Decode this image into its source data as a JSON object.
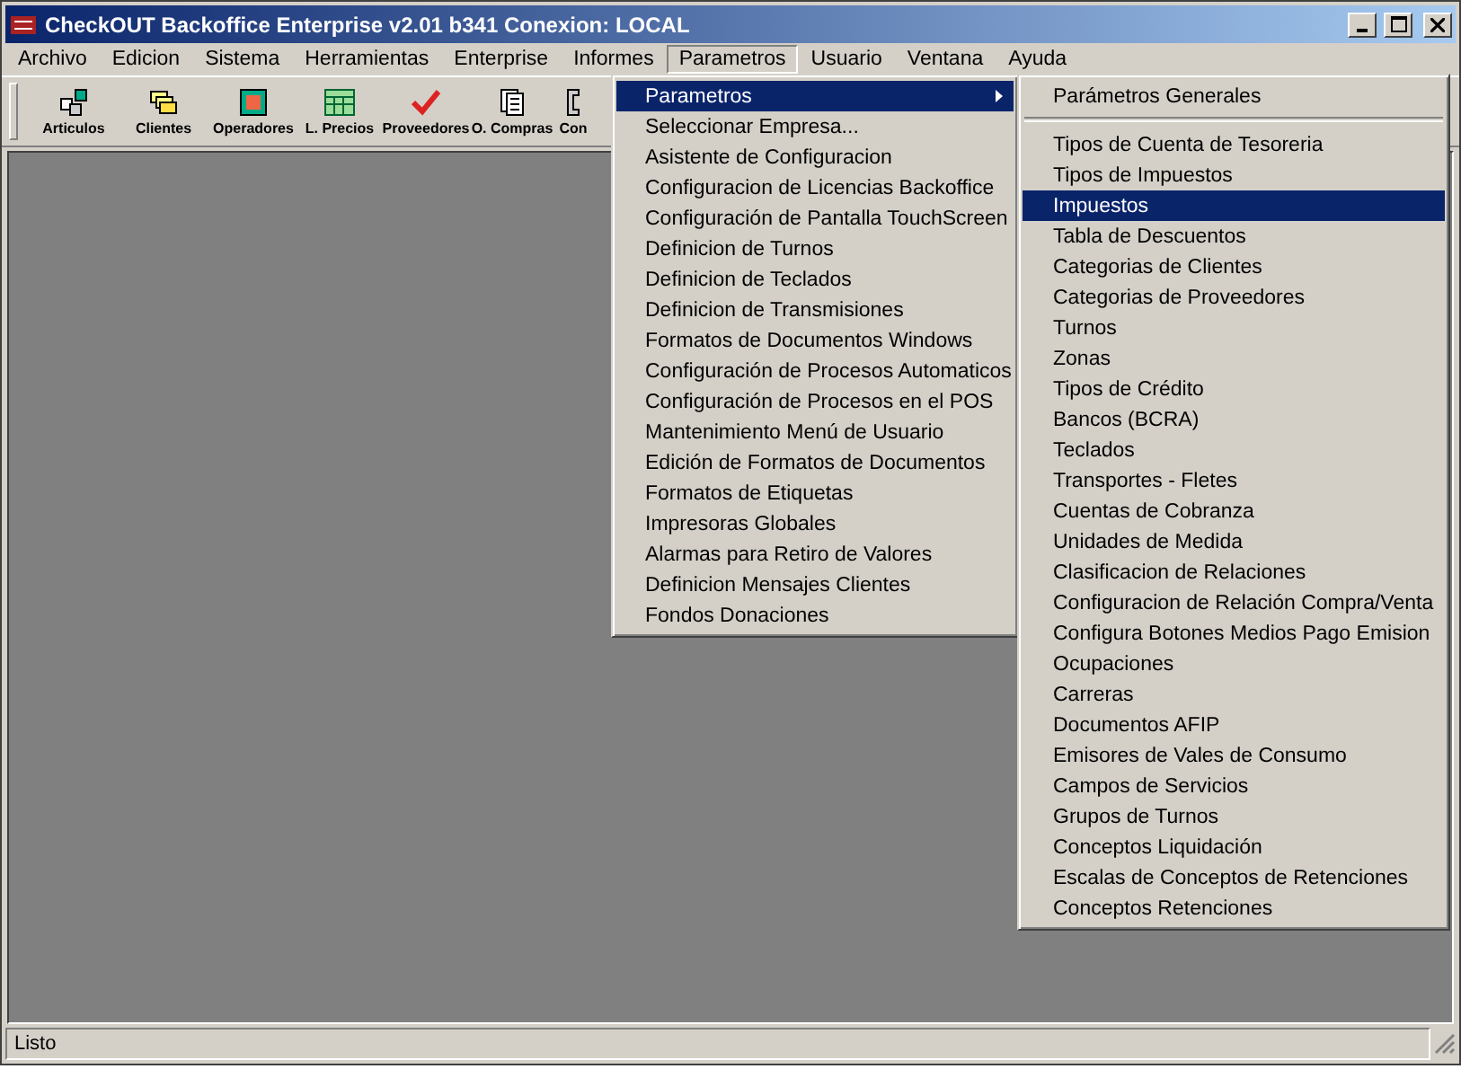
{
  "window": {
    "title": "CheckOUT Backoffice Enterprise v2.01 b341 Conexion: LOCAL"
  },
  "menu_bar": [
    {
      "label": "Archivo",
      "selected": false
    },
    {
      "label": "Edicion",
      "selected": false
    },
    {
      "label": "Sistema",
      "selected": false
    },
    {
      "label": "Herramientas",
      "selected": false
    },
    {
      "label": "Enterprise",
      "selected": false
    },
    {
      "label": "Informes",
      "selected": false
    },
    {
      "label": "Parametros",
      "selected": true
    },
    {
      "label": "Usuario",
      "selected": false
    },
    {
      "label": "Ventana",
      "selected": false
    },
    {
      "label": "Ayuda",
      "selected": false
    }
  ],
  "toolbar": [
    "Articulos",
    "Clientes",
    "Operadores",
    "L. Precios",
    "Proveedores",
    "O. Compras",
    "Con"
  ],
  "menu": [
    {
      "label": "Parametros",
      "selected": true,
      "submenu": true
    },
    {
      "label": "Seleccionar Empresa...",
      "selected": false
    },
    {
      "label": "Asistente de Configuracion",
      "selected": false
    },
    {
      "label": "Configuracion de Licencias Backoffice",
      "selected": false
    },
    {
      "label": "Configuración de Pantalla TouchScreen",
      "selected": false
    },
    {
      "label": "Definicion de Turnos",
      "selected": false
    },
    {
      "label": "Definicion de Teclados",
      "selected": false
    },
    {
      "label": "Definicion de Transmisiones",
      "selected": false
    },
    {
      "label": "Formatos de Documentos Windows",
      "selected": false
    },
    {
      "label": "Configuración de Procesos Automaticos",
      "selected": false
    },
    {
      "label": "Configuración de Procesos en el POS",
      "selected": false
    },
    {
      "label": "Mantenimiento Menú de Usuario",
      "selected": false
    },
    {
      "label": "Edición de Formatos de Documentos",
      "selected": false
    },
    {
      "label": "Formatos de Etiquetas",
      "selected": false
    },
    {
      "label": "Impresoras Globales",
      "selected": false
    },
    {
      "label": "Alarmas para Retiro de Valores",
      "selected": false
    },
    {
      "label": "Definicion Mensajes Clientes",
      "selected": false
    },
    {
      "label": "Fondos Donaciones",
      "selected": false
    }
  ],
  "submenu": [
    {
      "kind": "item",
      "label": "Parámetros Generales",
      "selected": false
    },
    {
      "kind": "separator"
    },
    {
      "kind": "item",
      "label": "Tipos de Cuenta de Tesoreria",
      "selected": false
    },
    {
      "kind": "item",
      "label": "Tipos de Impuestos",
      "selected": false
    },
    {
      "kind": "item",
      "label": "Impuestos",
      "selected": true
    },
    {
      "kind": "item",
      "label": "Tabla de Descuentos",
      "selected": false
    },
    {
      "kind": "item",
      "label": "Categorias de Clientes",
      "selected": false
    },
    {
      "kind": "item",
      "label": "Categorias de Proveedores",
      "selected": false
    },
    {
      "kind": "item",
      "label": "Turnos",
      "selected": false
    },
    {
      "kind": "item",
      "label": "Zonas",
      "selected": false
    },
    {
      "kind": "item",
      "label": "Tipos de Crédito",
      "selected": false
    },
    {
      "kind": "item",
      "label": "Bancos (BCRA)",
      "selected": false
    },
    {
      "kind": "item",
      "label": "Teclados",
      "selected": false
    },
    {
      "kind": "item",
      "label": "Transportes - Fletes",
      "selected": false
    },
    {
      "kind": "item",
      "label": "Cuentas de Cobranza",
      "selected": false
    },
    {
      "kind": "item",
      "label": "Unidades de Medida",
      "selected": false
    },
    {
      "kind": "item",
      "label": "Clasificacion de Relaciones",
      "selected": false
    },
    {
      "kind": "item",
      "label": "Configuracion de Relación Compra/Venta",
      "selected": false
    },
    {
      "kind": "item",
      "label": "Configura Botones Medios Pago Emision",
      "selected": false
    },
    {
      "kind": "item",
      "label": "Ocupaciones",
      "selected": false
    },
    {
      "kind": "item",
      "label": "Carreras",
      "selected": false
    },
    {
      "kind": "item",
      "label": "Documentos AFIP",
      "selected": false
    },
    {
      "kind": "item",
      "label": "Emisores de Vales de Consumo",
      "selected": false
    },
    {
      "kind": "item",
      "label": "Campos de Servicios",
      "selected": false
    },
    {
      "kind": "item",
      "label": "Grupos de Turnos",
      "selected": false
    },
    {
      "kind": "item",
      "label": "Conceptos Liquidación",
      "selected": false
    },
    {
      "kind": "item",
      "label": "Escalas de Conceptos de Retenciones",
      "selected": false
    },
    {
      "kind": "item",
      "label": "Conceptos Retenciones",
      "selected": false
    }
  ],
  "status_bar": {
    "text": "Listo"
  }
}
